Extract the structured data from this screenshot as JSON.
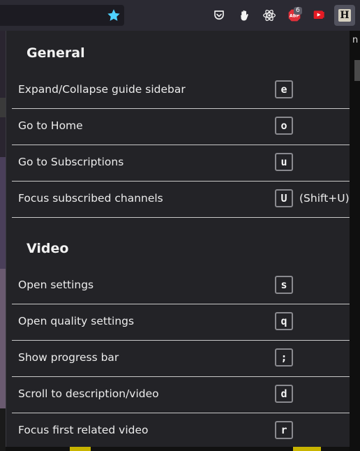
{
  "toolbar": {
    "extensions": [
      {
        "name": "pocket-icon"
      },
      {
        "name": "hand-icon"
      },
      {
        "name": "react-devtools-icon"
      },
      {
        "name": "adblock-icon",
        "label": "ABP",
        "badge": "6"
      },
      {
        "name": "youtube-extension-icon"
      },
      {
        "name": "hotkeys-extension-icon",
        "label": "H"
      }
    ]
  },
  "background": {
    "right_text": "n"
  },
  "popup": {
    "sections": [
      {
        "title": "General",
        "rows": [
          {
            "label": "Expand/Collapse guide sidebar",
            "key": "e"
          },
          {
            "label": "Go to Home",
            "key": "o"
          },
          {
            "label": "Go to Subscriptions",
            "key": "u"
          },
          {
            "label": "Focus subscribed channels",
            "key": "U",
            "note": "(Shift+U)"
          }
        ]
      },
      {
        "title": "Video",
        "rows": [
          {
            "label": "Open settings",
            "key": "s"
          },
          {
            "label": "Open quality settings",
            "key": "q"
          },
          {
            "label": "Show progress bar",
            "key": ";"
          },
          {
            "label": "Scroll to description/video",
            "key": "d"
          },
          {
            "label": "Focus first related video",
            "key": "r"
          }
        ]
      }
    ]
  },
  "colors": {
    "popup_bg": "#232327",
    "toolbar_bg": "#2b2a33",
    "star_accent": "#54ffbd",
    "separator": "#c9c9c9",
    "keycap_border": "#8a8a8f"
  }
}
